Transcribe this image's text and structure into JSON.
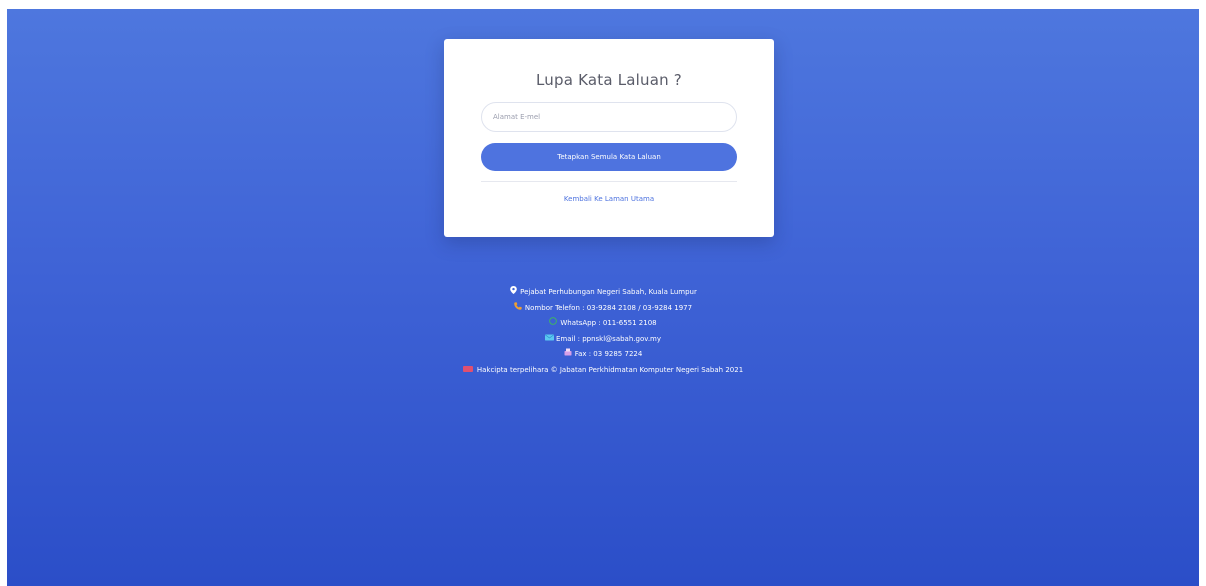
{
  "card": {
    "title": "Lupa Kata Laluan ?",
    "email_placeholder": "Alamat E-mel",
    "email_value": "",
    "reset_button_label": "Tetapkan Semula Kata Laluan",
    "home_link_label": "Kembali Ke Laman Utama"
  },
  "footer": {
    "office": "Pejabat Perhubungan Negeri Sabah, Kuala Lumpur",
    "phone": "Nombor Telefon : 03-9284 2108 / 03-9284 1977",
    "whatsapp": "WhatsApp : 011-6551 2108",
    "email": "Email : ppnskl@sabah.gov.my",
    "fax": "Fax : 03 9285 7224",
    "copyright": "Hakcipta terpelihara © Jabatan Perkhidmatan Komputer Negeri Sabah 2021"
  },
  "icons": {
    "office": "map-pin-icon",
    "phone": "phone-icon",
    "whatsapp": "whatsapp-icon",
    "email": "envelope-icon",
    "fax": "fax-icon",
    "copyright": "flag-icon"
  },
  "colors": {
    "background_top": "#4e77de",
    "background_bottom": "#2b4ec8",
    "button": "#4e73df",
    "link": "#4e73df",
    "title_text": "#5a5c69"
  }
}
